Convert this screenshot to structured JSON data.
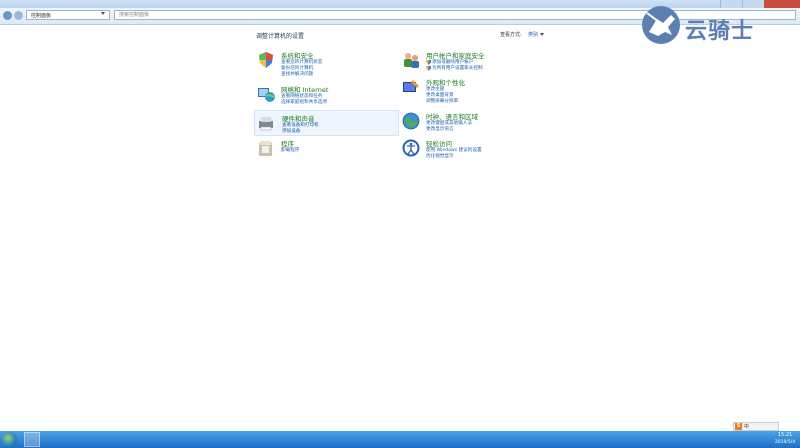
{
  "address": {
    "path": "控制面板"
  },
  "search": {
    "placeholder": "搜索控制面板"
  },
  "header": {
    "title": "调整计算机的设置",
    "view_by_label": "查看方式:",
    "view_by_value": "类别"
  },
  "categories": [
    {
      "title": "系统和安全",
      "icon": "system-security-icon",
      "links": [
        "查看您的计算机状态",
        "备份您的计算机",
        "查找并解决问题"
      ]
    },
    {
      "title": "网络和 Internet",
      "icon": "network-internet-icon",
      "links": [
        "查看网络状态和任务",
        "选择家庭组和共享选项"
      ]
    },
    {
      "title": "硬件和声音",
      "icon": "hardware-sound-icon",
      "links": [
        "查看设备和打印机",
        "添加设备"
      ]
    },
    {
      "title": "程序",
      "icon": "programs-icon",
      "links": [
        "卸载程序"
      ]
    },
    {
      "title": "用户帐户和家庭安全",
      "icon": "user-accounts-icon",
      "links": [
        "添加或删除用户帐户",
        "为所有用户设置家长控制"
      ]
    },
    {
      "title": "外观和个性化",
      "icon": "appearance-icon",
      "links": [
        "更改主题",
        "更改桌面背景",
        "调整屏幕分辨率"
      ]
    },
    {
      "title": "时钟、语言和区域",
      "icon": "clock-language-icon",
      "links": [
        "更改键盘或其他输入法",
        "更改显示语言"
      ]
    },
    {
      "title": "轻松访问",
      "icon": "ease-of-access-icon",
      "links": [
        "使用 Windows 建议的设置",
        "优化视觉显示"
      ]
    }
  ],
  "tray": {
    "ime": "S",
    "lang": "中"
  },
  "clock": {
    "time": "15:21",
    "date": "2019/5/4"
  },
  "watermark": {
    "text": "云骑士"
  },
  "colors": {
    "title_green": "#1d7a1d",
    "link_blue": "#1a5fb4",
    "taskbar": "#1f6fc4"
  }
}
